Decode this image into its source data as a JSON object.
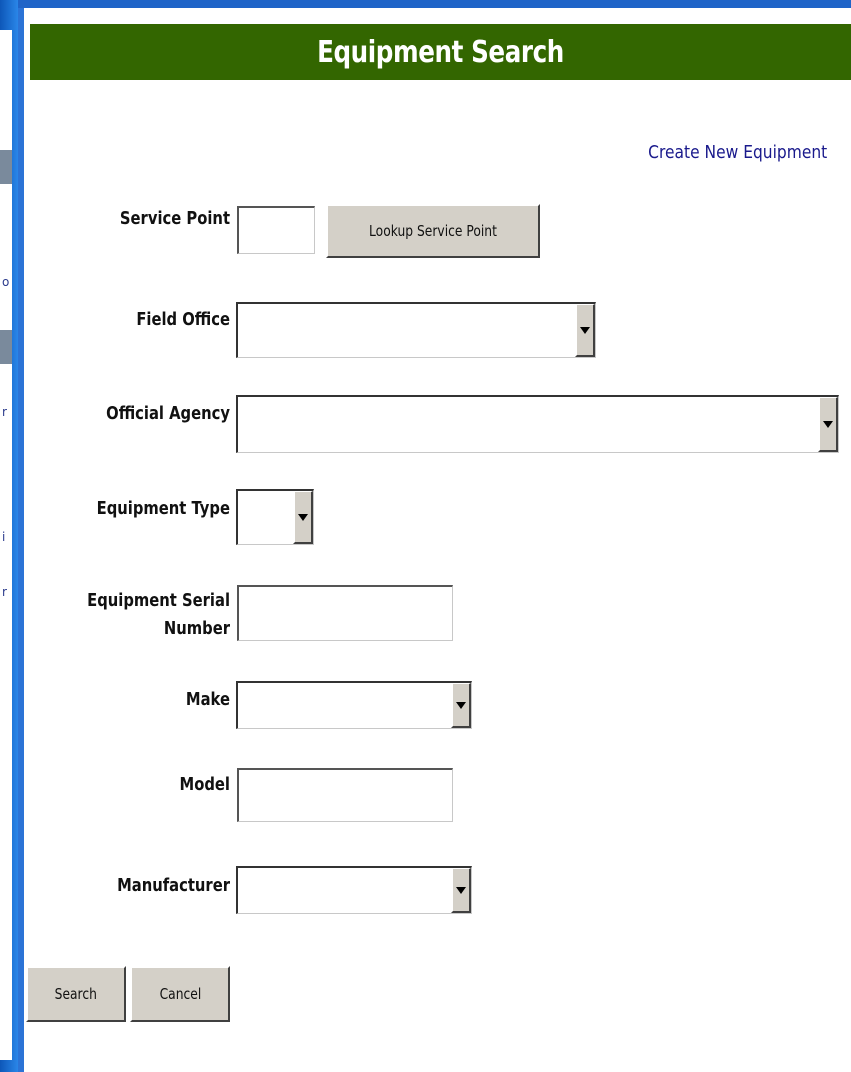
{
  "page": {
    "title": "Equipment Search",
    "create_link": "Create New Equipment"
  },
  "form": {
    "service_point": {
      "label": "Service Point",
      "value": "",
      "lookup_button": "Lookup Service Point"
    },
    "field_office": {
      "label": "Field Office",
      "selected": ""
    },
    "official_agency": {
      "label": "Official Agency",
      "selected": ""
    },
    "equipment_type": {
      "label": "Equipment Type",
      "selected": ""
    },
    "serial_number": {
      "label_line1": "Equipment Serial",
      "label_line2": "Number",
      "value": ""
    },
    "make": {
      "label": "Make",
      "selected": ""
    },
    "model": {
      "label": "Model",
      "value": ""
    },
    "manufacturer": {
      "label": "Manufacturer",
      "selected": ""
    }
  },
  "actions": {
    "search_label": "Search",
    "cancel_label": "Cancel"
  },
  "sidebar_glyphs": [
    "o",
    "r",
    "i",
    "r"
  ],
  "colors": {
    "title_bar": "#336600",
    "link": "#1a1a8c",
    "desktop": "#1a6fd0"
  },
  "icons": {
    "dropdown": "chevron-down-icon"
  }
}
